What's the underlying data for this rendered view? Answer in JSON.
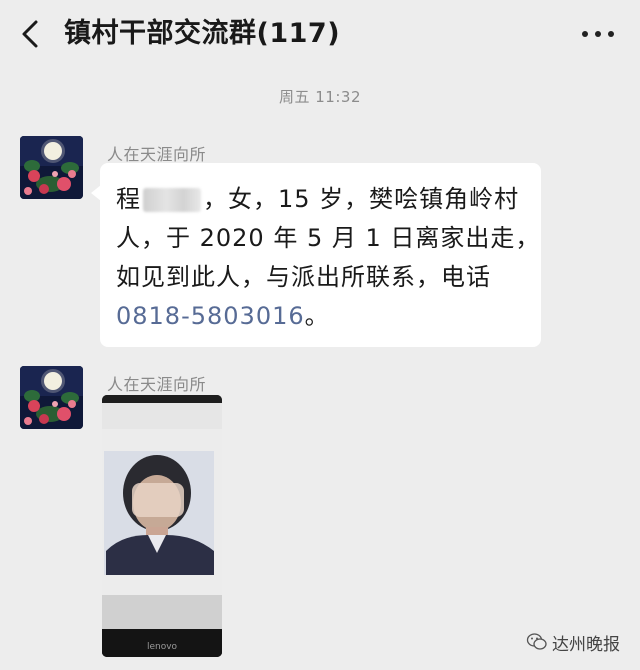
{
  "header": {
    "title": "镇村干部交流群(117)",
    "back_icon": "chevron-left-icon",
    "more_icon": "more-dots-icon"
  },
  "timestamp": "周五 11:32",
  "messages": [
    {
      "sender": "人在天涯向所",
      "type": "text",
      "lines": [
        [
          "程",
          "，女，15 岁，樊哙镇角岭村"
        ],
        "人，于 2020 年 5 月 1 日离家出走，",
        "如见到此人，与派出所联系，电话"
      ],
      "phone": "0818-5803016",
      "phone_suffix": "。"
    },
    {
      "sender": "人在天涯向所",
      "type": "image",
      "image_text": "lenovo"
    }
  ],
  "watermark": {
    "text": "达州晚报",
    "icon": "wechat-logo-icon"
  },
  "colors": {
    "background": "#ededed",
    "bubble": "#ffffff",
    "link": "#576b95",
    "meta_text": "#8a8a8a"
  }
}
